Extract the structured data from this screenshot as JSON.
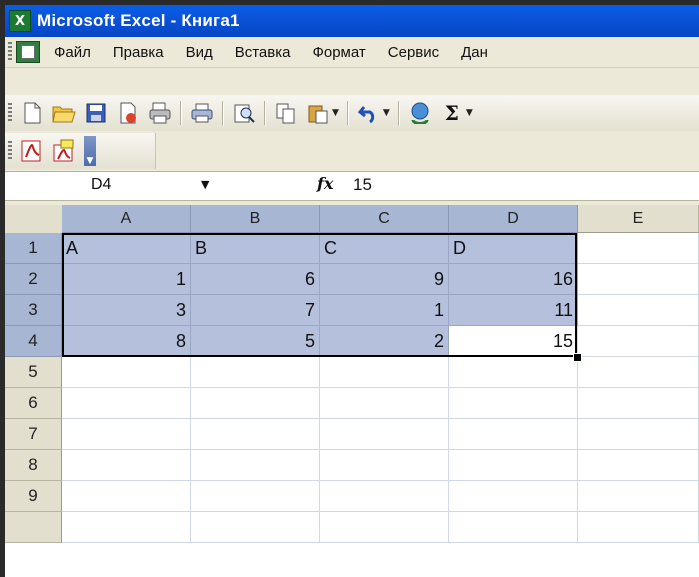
{
  "window": {
    "title": "Microsoft Excel - Книга1",
    "app_icon": "excel-icon"
  },
  "menu": [
    "Файл",
    "Правка",
    "Вид",
    "Вставка",
    "Формат",
    "Сервис",
    "Дан"
  ],
  "toolbar": {
    "icons": [
      "new-icon",
      "open-icon",
      "save-icon",
      "permission-icon",
      "print-area-icon",
      "print-icon",
      "research-icon",
      "copy-icon",
      "paste-icon",
      "undo-icon",
      "hyperlink-icon",
      "autosum-icon"
    ],
    "autosum_label": "Σ"
  },
  "pdf_toolbar": {
    "icons": [
      "pdf-convert-icon",
      "pdf-comment-icon",
      "toolbar-options-icon"
    ]
  },
  "formula_bar": {
    "name_box": "D4",
    "fx_label": "fx",
    "value": "15"
  },
  "sheet": {
    "columns": [
      "A",
      "B",
      "C",
      "D",
      "E"
    ],
    "rows": [
      "1",
      "2",
      "3",
      "4",
      "5",
      "6",
      "7",
      "8",
      "9"
    ],
    "cells": [
      [
        "A",
        "B",
        "C",
        "D"
      ],
      [
        "1",
        "6",
        "9",
        "16"
      ],
      [
        "3",
        "7",
        "1",
        "11"
      ],
      [
        "8",
        "5",
        "2",
        "15"
      ]
    ],
    "active_cell": "D4",
    "selection": "A1:D4",
    "selection_color": "#b5c0dd"
  }
}
